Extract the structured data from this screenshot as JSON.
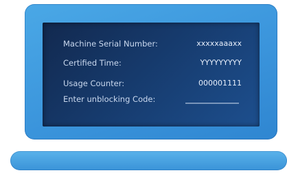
{
  "panel": {
    "rows": [
      {
        "label": "Machine Serial Number:",
        "value": "xxxxxaaaxx"
      },
      {
        "label": "Certified Time:",
        "value": "YYYYYYYYY"
      },
      {
        "label": "Usage Counter:",
        "value": "000001111"
      },
      {
        "label": "Enter unblocking Code:",
        "value": ""
      }
    ],
    "code_placeholder": ""
  },
  "colors": {
    "frame": "#3b95dc",
    "screen": "#163a6c",
    "text": "#c9d8ee"
  }
}
